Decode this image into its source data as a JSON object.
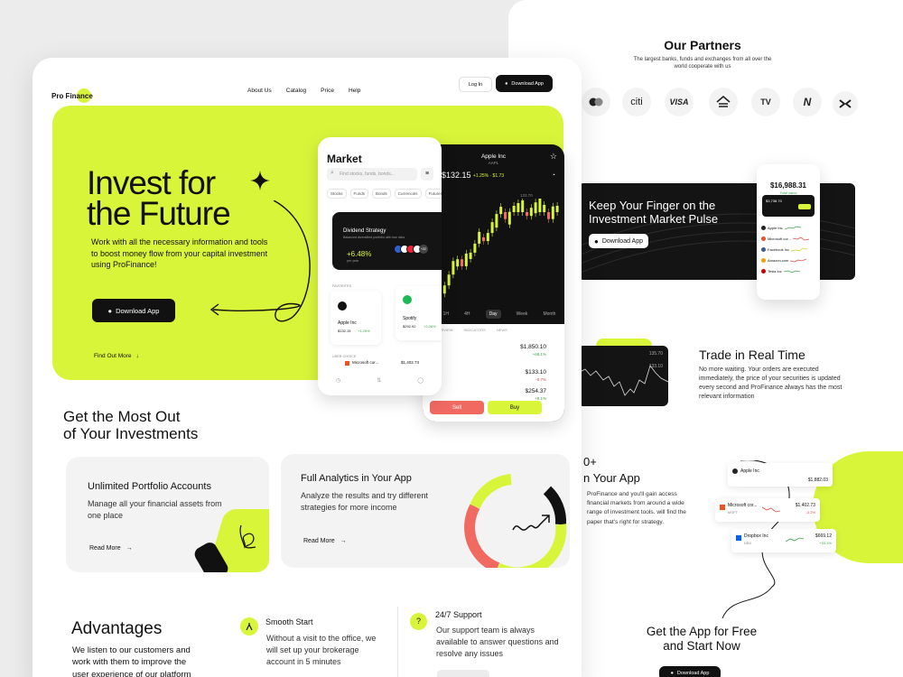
{
  "nav": {
    "logo": "Pro Finance",
    "links": [
      "About Us",
      "Catalog",
      "Price",
      "Help"
    ],
    "login": "Log In",
    "download": "Download App"
  },
  "hero": {
    "title_line1": "Invest for",
    "title_line2": "the Future",
    "desc": "Work with all the necessary information and tools to boost money flow from your capital investment using ProFinance!",
    "cta": "Download App",
    "find_more": "Find Out More"
  },
  "market_phone": {
    "title": "Market",
    "search_placeholder": "Find stocks, funds, bonds...",
    "chips": [
      "Stocks",
      "Funds",
      "Bonds",
      "Currencies",
      "Futures"
    ],
    "collections_label": "COLLECTIONS",
    "dividend_title": "Dividend Strategy",
    "dividend_sub": "Balanced diversified portfolio with low risks",
    "dividend_value": "+6.48%",
    "dividend_period": "per year",
    "dividend_more": "+32",
    "favorites_label": "FAVORITES",
    "fav1_name": "Apple Inc",
    "fav1_price": "$132.15",
    "fav1_change": "+1.25%",
    "fav2_name": "Spotify",
    "fav2_price": "$292.92",
    "fav2_change": "+2.06%",
    "users_choice": "USER CHOICE",
    "uc_name": "Microsoft cor...",
    "uc_price": "$1,402.73"
  },
  "chart_phone": {
    "title": "Apple Inc",
    "ticker": "AAPL",
    "price": "$132.15",
    "change": "+1.25% · $1.73",
    "high": "133.70",
    "periods": [
      "1H",
      "4H",
      "Day",
      "Week",
      "Month"
    ],
    "active_period": "Day",
    "tabs": [
      "OVERVIEW",
      "INDICATORS",
      "NEWS"
    ],
    "prices": [
      "$1,850.10",
      "$133.10",
      "$254.37"
    ],
    "changes": [
      "+68.1%",
      "-0.7%",
      "+8.1%"
    ],
    "sell": "Sell",
    "buy": "Buy"
  },
  "section2": {
    "title_line1": "Get the Most Out",
    "title_line2": "of Your Investments",
    "card1_title": "Unlimited Portfolio Accounts",
    "card1_desc": "Manage all your financial assets from one place",
    "card1_link": "Read More",
    "card2_title": "Full Analytics in Your App",
    "card2_desc": "Analyze the results and try different strategies for more income",
    "card2_link": "Read More"
  },
  "advantages": {
    "title": "Advantages",
    "desc": "We listen to our customers and work with them to improve the user experience of our platform",
    "item1_title": "Smooth Start",
    "item1_desc": "Without a visit to the office, we will set up your brokerage account in 5 minutes",
    "item2_title": "24/7 Support",
    "item2_desc": "Our support team is always available to answer questions and resolve any issues",
    "item2_icon": "?"
  },
  "partners": {
    "title": "Our Partners",
    "desc": "The largest banks, funds and exchanges from all over the world cooperate with us",
    "logos": [
      "citi",
      "VISA",
      "TV",
      "N"
    ]
  },
  "pulse": {
    "title_line1": "Keep Your Finger on the",
    "title_line2": "Investment Market Pulse",
    "cta": "Download App",
    "phone_balance": "$16,988.31",
    "phone_sub": "Total value",
    "card_value": "$3,738.70",
    "stocks": [
      "Apple Inc",
      "Microsoft cor...",
      "Facebook Inc",
      "Amazon.com",
      "Tesla Inc"
    ]
  },
  "realtime": {
    "title": "Trade in Real Time",
    "desc": "No more waiting. Your orders are executed immediately, the price of your securities is updated every second and ProFinance always has the most relevant information",
    "high": "135.70",
    "low": "133.10"
  },
  "markets": {
    "title_line1": "0+",
    "title_line2": "n Your App",
    "desc": "ProFinance and you'll gain access financial markets from around a wide range of investment tools. will find the paper that's right for strategy.",
    "c1_name": "Apple Inc",
    "c1_price": "$1,882.03",
    "c1_change": "",
    "c2_name": "Microsoft cor...",
    "c2_sub": "MSFT",
    "c2_price": "$1,402.73",
    "c2_change": "-3.2%",
    "c3_name": "Dropbox Inc",
    "c3_sub": "DBX",
    "c3_price": "$669.12",
    "c3_change": "+33.1%"
  },
  "getapp": {
    "title_line1": "Get the App for Free",
    "title_line2": "and Start Now",
    "cta": "Download App"
  },
  "colors": {
    "lime": "#d9f53a",
    "dark": "#141414",
    "sell": "#f06a62",
    "buy": "#d9f53a"
  }
}
